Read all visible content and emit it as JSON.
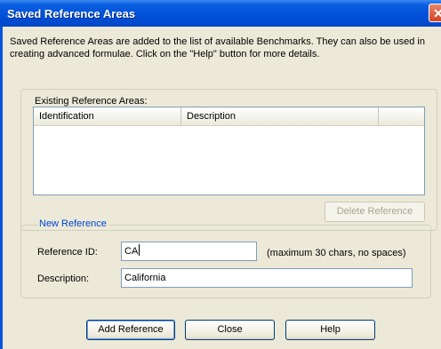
{
  "window": {
    "title": "Saved Reference Areas",
    "close_glyph": "✕"
  },
  "intro_text": "Saved Reference Areas are added to the list of available Benchmarks.  They can also be used in creating advanced formulae.  Click on the \"Help\" button for more details.",
  "existing": {
    "legend": "Existing Reference Areas:",
    "columns": [
      "Identification",
      "Description"
    ],
    "rows": []
  },
  "delete_label": "Delete Reference",
  "new_reference": {
    "legend": "New Reference",
    "id_label": "Reference ID:",
    "id_value": "CA",
    "id_hint": "(maximum 30 chars, no spaces)",
    "desc_label": "Description:",
    "desc_value": "California"
  },
  "buttons": {
    "add": "Add Reference",
    "close": "Close",
    "help": "Help"
  },
  "colors": {
    "title_bar": "#0a5fe0",
    "dialog_bg": "#ece9d8",
    "legend_text": "#0046d5",
    "close_button": "#d44424"
  }
}
